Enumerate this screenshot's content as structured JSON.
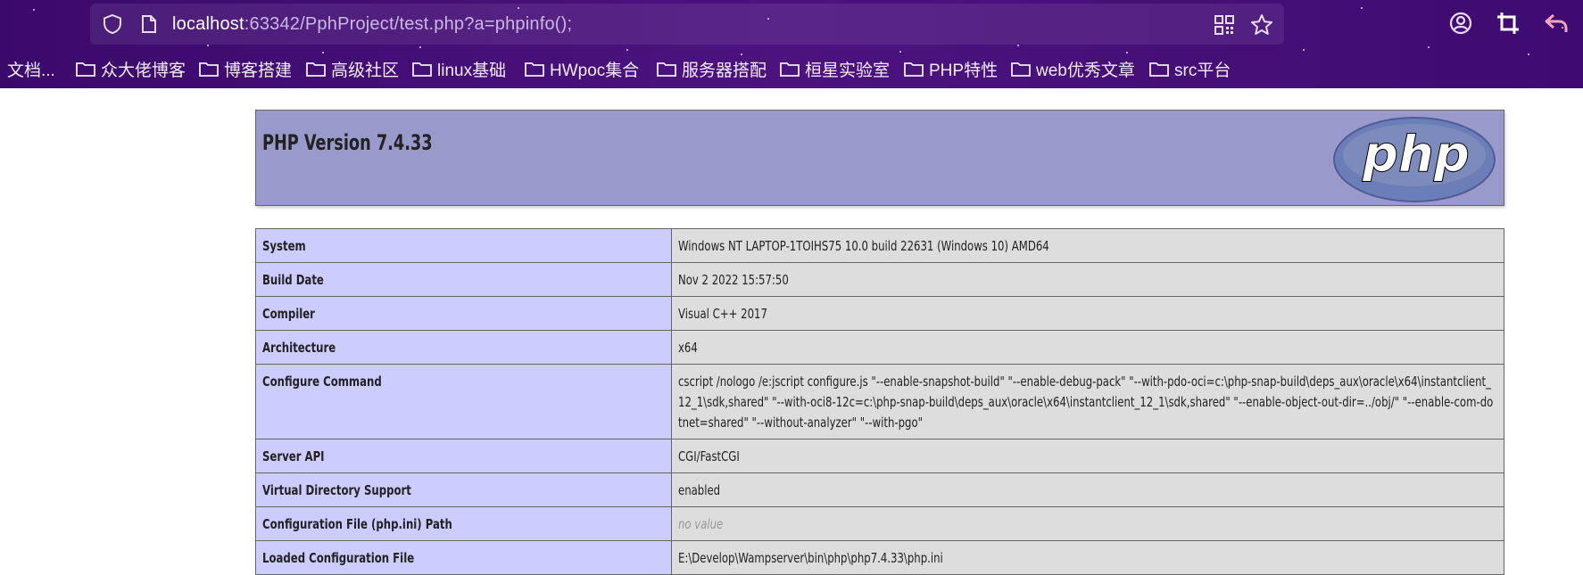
{
  "browser": {
    "url_host": "localhost",
    "url_rest": ":63342/PphProject/test.php?a=phpinfo();",
    "bookmarks": [
      {
        "label": "文档..."
      },
      {
        "label": "众大佬博客"
      },
      {
        "label": "博客搭建"
      },
      {
        "label": "高级社区"
      },
      {
        "label": "linux基础"
      },
      {
        "label": "HWpoc集合"
      },
      {
        "label": "服务器搭配"
      },
      {
        "label": "桓星实验室"
      },
      {
        "label": "PHP特性"
      },
      {
        "label": "web优秀文章"
      },
      {
        "label": "src平台"
      }
    ]
  },
  "phpinfo": {
    "title": "PHP Version 7.4.33",
    "logo_text": "php",
    "rows": [
      {
        "key": "System",
        "value": "Windows NT LAPTOP-1TOIHS75 10.0 build 22631 (Windows 10) AMD64"
      },
      {
        "key": "Build Date",
        "value": "Nov 2 2022 15:57:50"
      },
      {
        "key": "Compiler",
        "value": "Visual C++ 2017"
      },
      {
        "key": "Architecture",
        "value": "x64"
      },
      {
        "key": "Configure Command",
        "value": "cscript /nologo /e:jscript configure.js \"--enable-snapshot-build\" \"--enable-debug-pack\" \"--with-pdo-oci=c:\\php-snap-build\\deps_aux\\oracle\\x64\\instantclient_12_1\\sdk,shared\" \"--with-oci8-12c=c:\\php-snap-build\\deps_aux\\oracle\\x64\\instantclient_12_1\\sdk,shared\" \"--enable-object-out-dir=../obj/\" \"--enable-com-dotnet=shared\" \"--without-analyzer\" \"--with-pgo\""
      },
      {
        "key": "Server API",
        "value": "CGI/FastCGI"
      },
      {
        "key": "Virtual Directory Support",
        "value": "enabled"
      },
      {
        "key": "Configuration File (php.ini) Path",
        "value": "no value"
      },
      {
        "key": "Loaded Configuration File",
        "value": "E:\\Develop\\Wampserver\\bin\\php\\php7.4.33\\php.ini"
      }
    ]
  },
  "colors": {
    "chrome_bg": "#4c137f",
    "header_bg": "#9999cc",
    "key_bg": "#ccccff",
    "value_bg": "#dddddd"
  }
}
